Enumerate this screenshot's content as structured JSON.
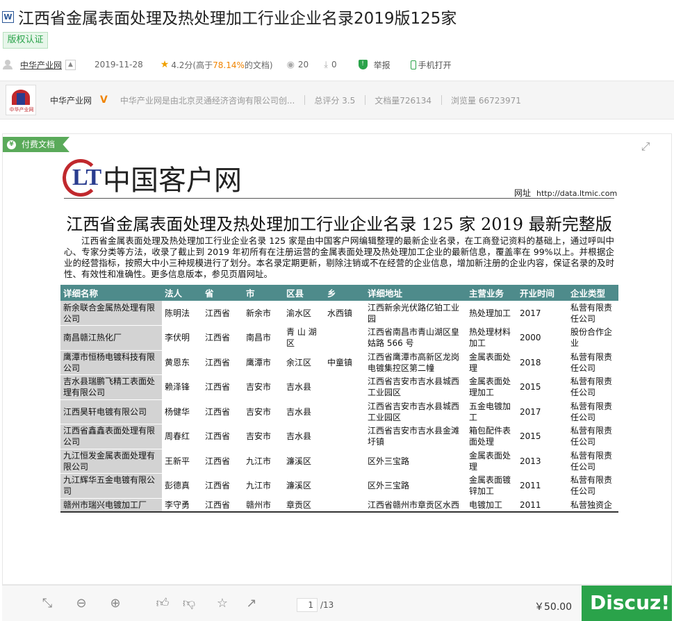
{
  "header": {
    "file_icon": "word-doc-icon",
    "title": "江西省金属表面处理及热处理加工行业企业名录2019版125家",
    "cert_label": "版权认证"
  },
  "meta": {
    "author": "中华产业网",
    "date": "2019-11-28",
    "rating_score": "4.2分",
    "rating_prefix": "(高于",
    "rating_pct": "78.14%",
    "rating_suffix": "的文档)",
    "views": "20",
    "downloads": "0",
    "report_label": "举报",
    "mobile_label": "手机打开"
  },
  "author_bar": {
    "logo_text": "中华产业网",
    "name": "中华产业网",
    "desc": "中华产业网是由北京灵通经济咨询有限公司创...",
    "score": "总评分 3.5",
    "docs": "文档量726134",
    "browse": "浏览量 66723971"
  },
  "viewer": {
    "paid_label": "付费文档",
    "brand_mark": "LT",
    "brand_name": "中国客户网",
    "url_label": "网址",
    "url": "http://data.ltmic.com",
    "doc_title": "江西省金属表面处理及热处理加工行业企业名录 125 家 2019 最新完整版",
    "intro": "江西省金属表面处理及热处理加工行业企业名录 125 家是由中国客户网编辑整理的最新企业名录，在工商登记资料的基础上，通过呼叫中心、专家分类等方法，收录了截止到 2019 年初所有在注册运营的金属表面处理及热处理加工企业的最新信息，覆盖率在 99%以上。并根据企业的经营指标，按照大中小三种规模进行了划分。本名录定期更新，剔除注销或不在经营的企业信息，增加新注册的企业内容，保证名录的及时性、有效性和准确性。更多信息版本，参见页眉网址。",
    "table": {
      "headers": [
        "详细名称",
        "法人",
        "省",
        "市",
        "区县",
        "乡",
        "详细地址",
        "主营业务",
        "开业时间",
        "企业类型"
      ],
      "rows": [
        [
          "新余联合金属热处理有限公司",
          "陈明法",
          "江西省",
          "新余市",
          "渝水区",
          "水西镇",
          "江西新余光伏路亿铂工业园",
          "热处理加工",
          "2017",
          "私营有限责任公司"
        ],
        [
          "南昌赣江热化厂",
          "李伏明",
          "江西省",
          "南昌市",
          "青 山 湖 区",
          "",
          "江西省南昌市青山湖区皇姑路 566 号",
          "热处理材料加工",
          "2000",
          "股份合作企业"
        ],
        [
          "鹰潭市恒杨电镀科技有限公司",
          "黄恩东",
          "江西省",
          "鹰潭市",
          "余江区",
          "中童镇",
          "江西省鹰潭市高新区龙岗电镀集控区第二幢",
          "金属表面处理",
          "2018",
          "私营有限责任公司"
        ],
        [
          "吉水县瑞鹏飞精工表面处理有限公司",
          "赖泽锋",
          "江西省",
          "吉安市",
          "吉水县",
          "",
          "江西省吉安市吉水县城西工业园区",
          "金属表面处理加工",
          "2015",
          "私营有限责任公司"
        ],
        [
          "江西昊轩电镀有限公司",
          "杨健华",
          "江西省",
          "吉安市",
          "吉水县",
          "",
          "江西省吉安市吉水县城西工业园区",
          "五金电镀加工",
          "2017",
          "私营有限责任公司"
        ],
        [
          "江西省鑫鑫表面处理有限公司",
          "周春红",
          "江西省",
          "吉安市",
          "吉水县",
          "",
          "江西省吉安市吉水县金滩圩镇",
          "箱包配件表面处理",
          "2015",
          "私营有限责任公司"
        ],
        [
          "九江恒发金属表面处理有限公司",
          "王新平",
          "江西省",
          "九江市",
          "濂溪区",
          "",
          "区外三宝路",
          "金属表面处理",
          "2013",
          "私营有限责任公司"
        ],
        [
          "九江辉华五金电镀有限公司",
          "彭德真",
          "江西省",
          "九江市",
          "濂溪区",
          "",
          "区外三宝路",
          "金属表面镀锌加工",
          "2011",
          "私营有限责任公司"
        ],
        [
          "赣州市瑞兴电镀加工厂",
          "李守勇",
          "江西省",
          "赣州市",
          "章贡区",
          "",
          "江西省赣州市章贡区水西",
          "电镀加工",
          "2011",
          "私营独资企"
        ]
      ]
    }
  },
  "toolbar": {
    "page_current": "1",
    "page_total": "/13",
    "price": "￥50.00",
    "watermark": "Discuz!"
  }
}
